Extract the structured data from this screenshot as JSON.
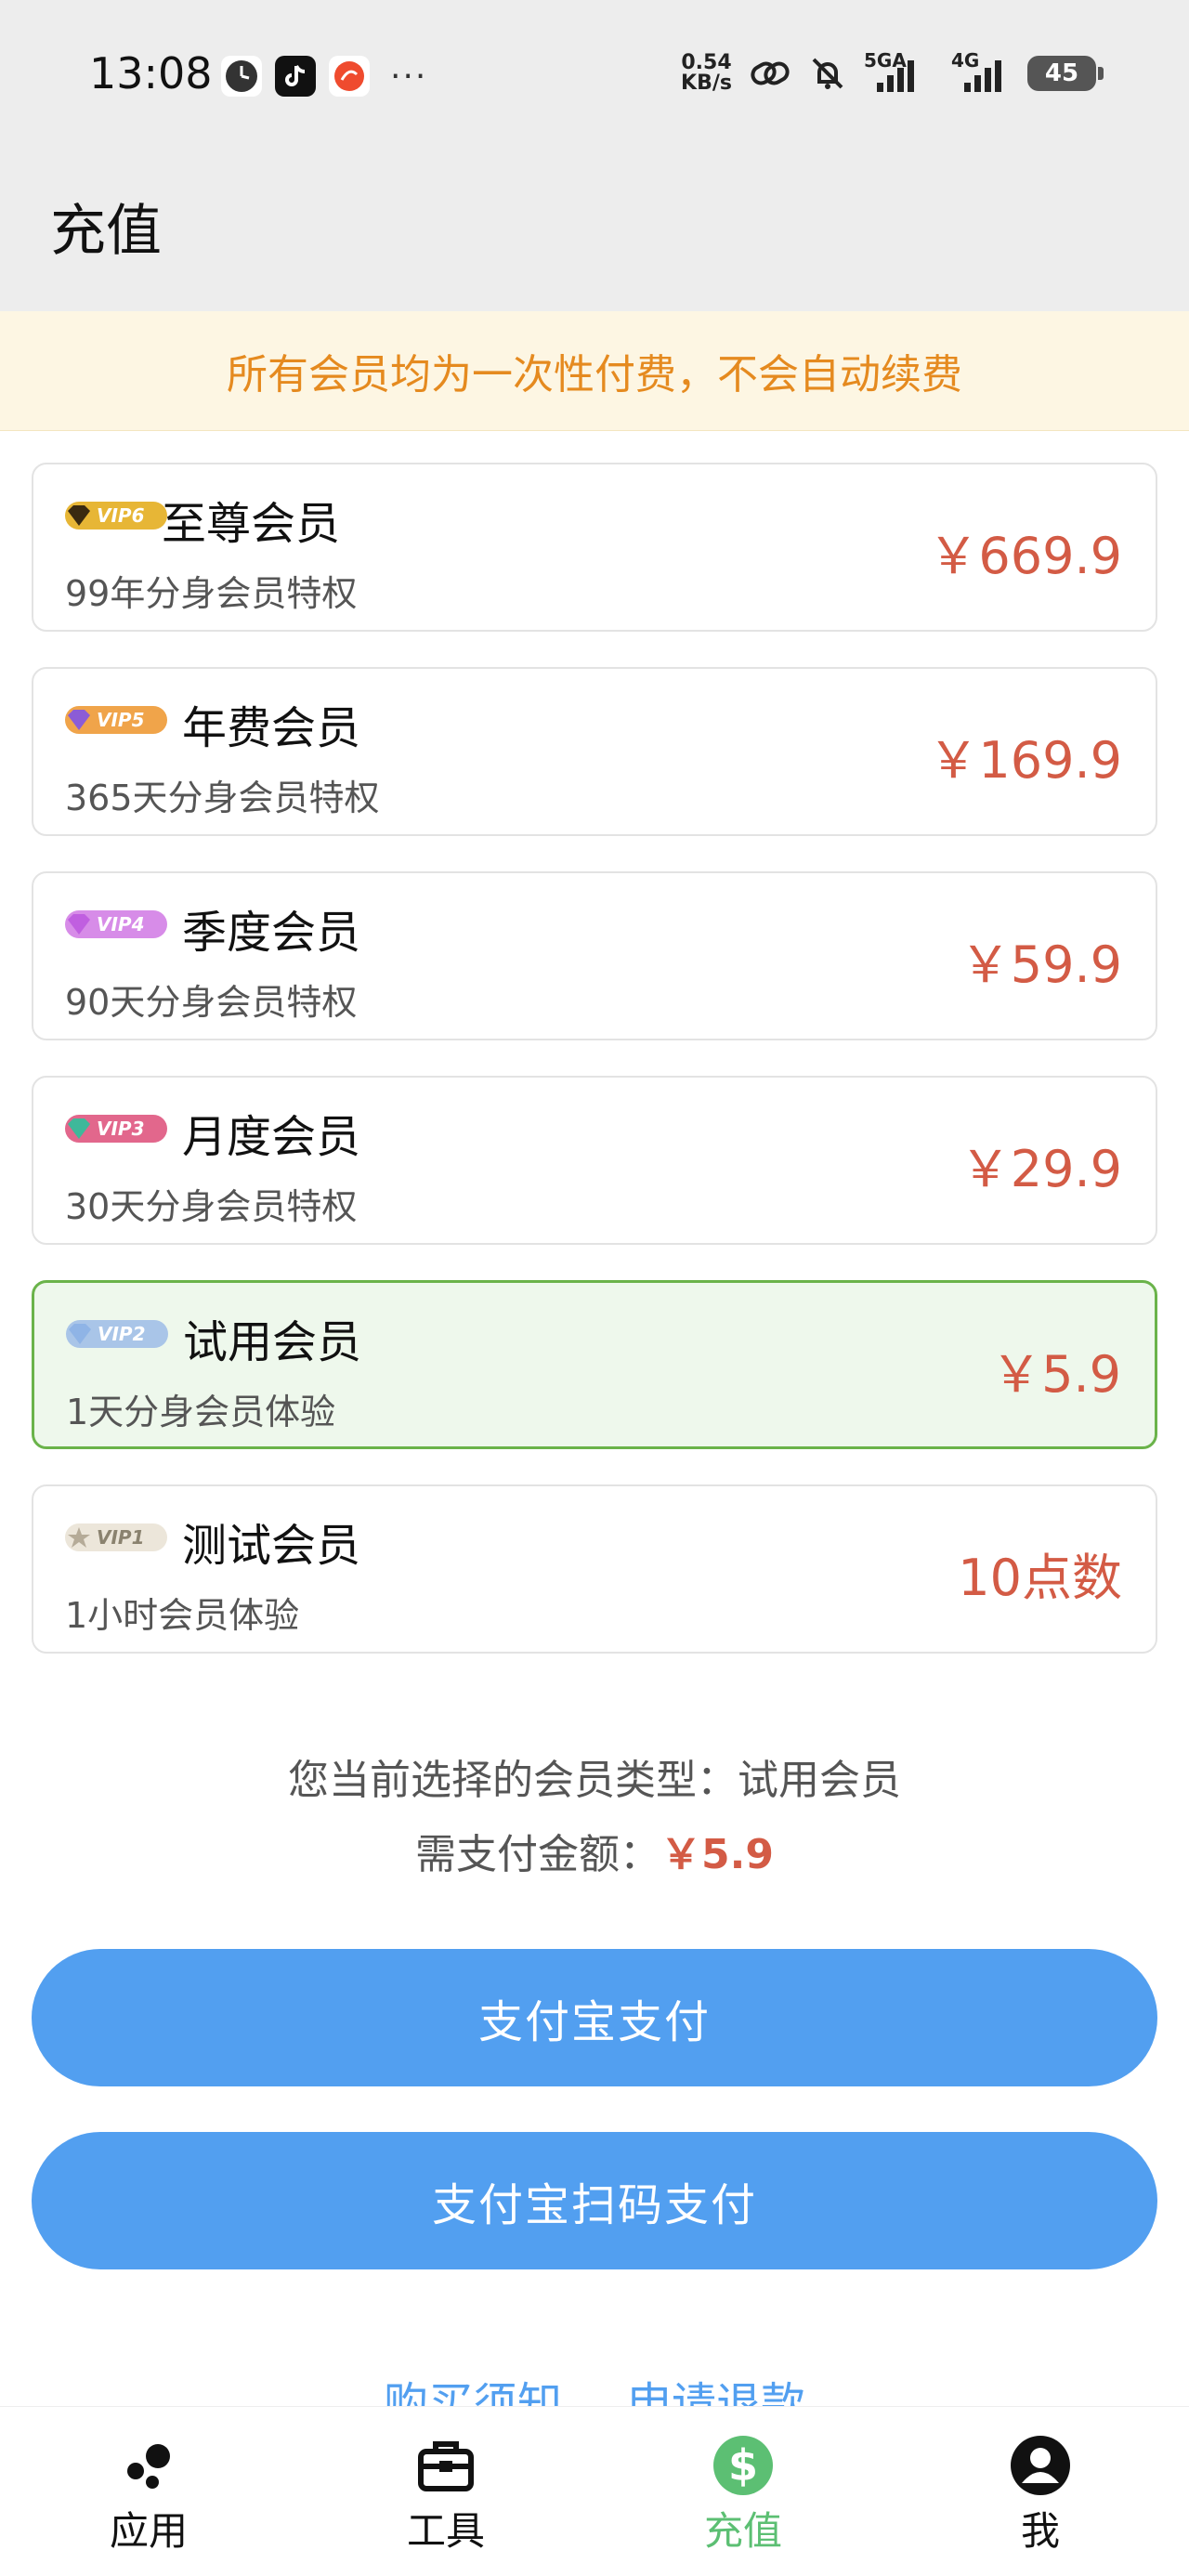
{
  "status_bar": {
    "time": "13:08",
    "net_speed_value": "0.54",
    "net_speed_unit": "KB/s",
    "signal1_label": "5GA",
    "signal2_label": "4G",
    "battery_level": "45"
  },
  "header": {
    "title": "充值"
  },
  "notice": "所有会员均为一次性付费，不会自动续费",
  "plans": [
    {
      "badge": "VIP6",
      "name": "至尊会员",
      "desc": "99年分身会员特权",
      "price": "￥669.9",
      "badge_color": "#e7b636",
      "gem_color": "#3a2a10"
    },
    {
      "badge": "VIP5",
      "name": "年费会员",
      "desc": "365天分身会员特权",
      "price": "￥169.9",
      "badge_color": "#f0a44a",
      "gem_color": "#8b5cd6"
    },
    {
      "badge": "VIP4",
      "name": "季度会员",
      "desc": "90天分身会员特权",
      "price": "￥59.9",
      "badge_color": "#d78ce8",
      "gem_color": "#c05fe0"
    },
    {
      "badge": "VIP3",
      "name": "月度会员",
      "desc": "30天分身会员特权",
      "price": "￥29.9",
      "badge_color": "#e2678c",
      "gem_color": "#3fb89a"
    },
    {
      "badge": "VIP2",
      "name": "试用会员",
      "desc": "1天分身会员体验",
      "price": "￥5.9",
      "badge_color": "#a9c5e8",
      "gem_color": "#8fb4e6",
      "selected": true
    },
    {
      "badge": "VIP1",
      "name": "测试会员",
      "desc": "1小时会员体验",
      "price": "10点数",
      "badge_color": "#ece6da",
      "gem_color": "#b5ab98"
    }
  ],
  "summary": {
    "selected_label": "您当前选择的会员类型：",
    "selected_value": "试用会员",
    "amount_label": "需支付金额：",
    "amount_value": "￥5.9"
  },
  "buttons": {
    "alipay": "支付宝支付",
    "alipay_qr": "支付宝扫码支付"
  },
  "links": {
    "notice": "购买须知",
    "refund": "申请退款"
  },
  "tabs": [
    {
      "label": "应用",
      "icon": "apps-dots-icon"
    },
    {
      "label": "工具",
      "icon": "toolbox-icon"
    },
    {
      "label": "充值",
      "icon": "dollar-coin-icon",
      "active": true
    },
    {
      "label": "我",
      "icon": "user-avatar-icon"
    }
  ],
  "colors": {
    "accent_blue": "#529ff0",
    "price_red": "#d35b45",
    "notice_orange": "#e58a1f",
    "selected_green": "#6ab34a",
    "tab_active": "#5cbf73"
  }
}
